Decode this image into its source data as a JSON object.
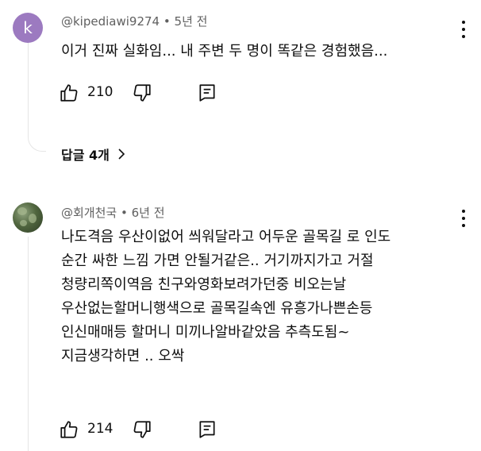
{
  "comments": [
    {
      "avatar_letter": "k",
      "avatar_color": "#9c7ac0",
      "author": "@kipediawi9274",
      "time": "5년 전",
      "body": [
        "이거 진짜 실화임... 내 주변 두 명이 똑같은 경험했음..."
      ],
      "likes": "210",
      "replies_label": "답글 4개"
    },
    {
      "author": "@회개천국",
      "time": "6년 전",
      "body": [
        "나도격음 우산이없어 씌워달라고 어두운 골목길 로 인도",
        "순간 싸한 느낌 가면 안될거같은.. 거기까지가고 거절",
        "청량리쪽이역음 친구와영화보려가던중 비오는날",
        "우산없는할머니행색으로 골목길속엔 유흥가나쁜손등",
        "인신매매등 할머니 미끼나알바같았음 추측도됨~",
        "지금생각하면 .. 오싹"
      ],
      "likes": "214"
    }
  ],
  "separator": "•",
  "icons": {
    "like": "thumbs-up-icon",
    "dislike": "thumbs-down-icon",
    "reply": "reply-comment-icon",
    "more": "more-vertical-icon",
    "expand": "chevron-right-icon"
  }
}
